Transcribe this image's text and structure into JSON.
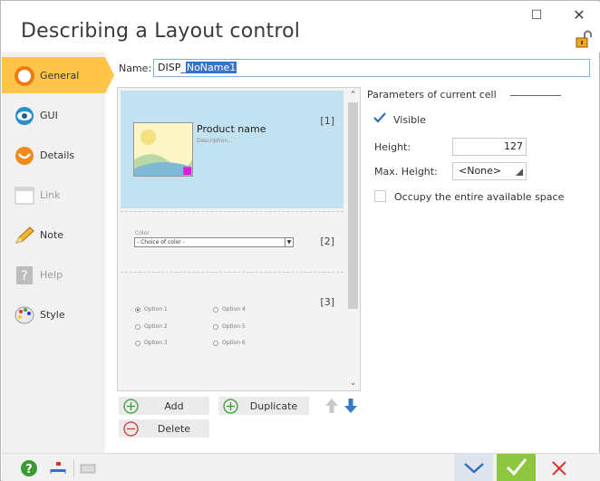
{
  "window": {
    "title": "Describing a Layout control",
    "minimize_glyph": "☐",
    "close_glyph": "✕"
  },
  "sidebar": {
    "items": [
      {
        "label": "General",
        "icon": "general-circle-icon",
        "active": true
      },
      {
        "label": "GUI",
        "icon": "eye-icon"
      },
      {
        "label": "Details",
        "icon": "details-circle-icon"
      },
      {
        "label": "Link",
        "icon": "link-box-icon",
        "disabled": true
      },
      {
        "label": "Note",
        "icon": "pencil-icon"
      },
      {
        "label": "Help",
        "icon": "help-box-icon",
        "disabled": true
      },
      {
        "label": "Style",
        "icon": "palette-icon"
      }
    ]
  },
  "name": {
    "label": "Name:",
    "prefix": "DISP_",
    "selected": "NoName1"
  },
  "cells": [
    {
      "index": "[1]",
      "product_name": "Product name",
      "description": "Description..."
    },
    {
      "index": "[2]",
      "color_label": "Color",
      "color_value": "- Choice of color -"
    },
    {
      "index": "[3]",
      "options": [
        "Option 1",
        "Option 2",
        "Option 3",
        "Option 4",
        "Option 5",
        "Option 6"
      ]
    }
  ],
  "buttons": {
    "add": "Add",
    "duplicate": "Duplicate",
    "delete": "Delete"
  },
  "params": {
    "title": "Parameters of current cell",
    "visible_label": "Visible",
    "visible_checked": true,
    "height_label": "Height:",
    "height_value": "127",
    "max_height_label": "Max. Height:",
    "max_height_value": "<None>",
    "occupy_label": "Occupy the entire available space",
    "occupy_checked": false
  },
  "colors": {
    "active_nav": "#ffc44a",
    "ok_button": "#8dc63f",
    "selected_cell": "#c3e2f1",
    "selection": "#3b73c4"
  }
}
